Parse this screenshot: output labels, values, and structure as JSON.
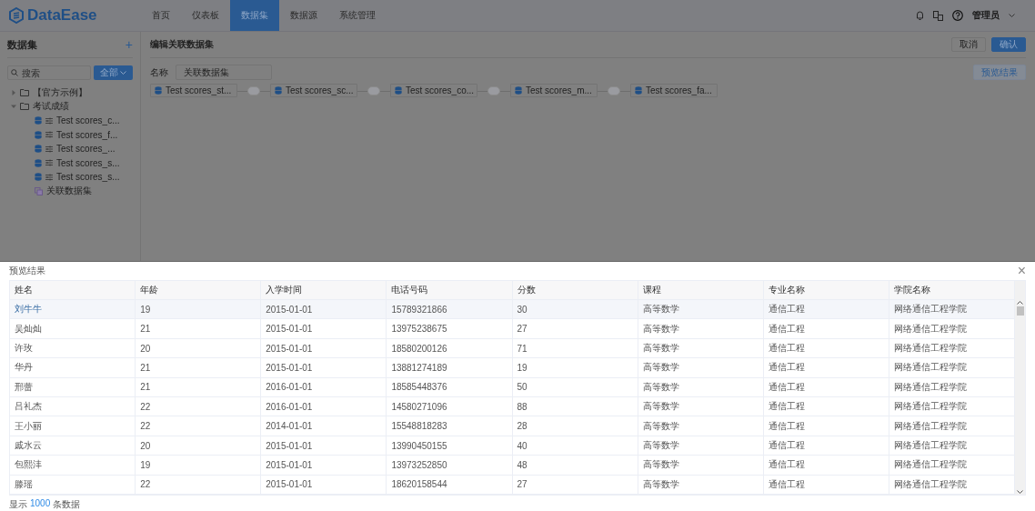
{
  "brand": {
    "name": "DataEase"
  },
  "nav": [
    {
      "label": "首页",
      "selected": false
    },
    {
      "label": "仪表板",
      "selected": false
    },
    {
      "label": "数据集",
      "selected": true
    },
    {
      "label": "数据源",
      "selected": false
    },
    {
      "label": "系统管理",
      "selected": false
    }
  ],
  "user": {
    "name": "管理员"
  },
  "sidebar": {
    "title": "数据集",
    "add": "+",
    "search": {
      "placeholder": "搜索"
    },
    "filter": "全部",
    "tree": [
      {
        "label": "【官方示例】",
        "kind": "folder",
        "expanded": false
      },
      {
        "label": "考试成绩",
        "kind": "folder",
        "expanded": true,
        "children": [
          {
            "label": "Test scores_c...",
            "kind": "dataset"
          },
          {
            "label": "Test scores_f...",
            "kind": "dataset"
          },
          {
            "label": "Test scores_...",
            "kind": "dataset"
          },
          {
            "label": "Test scores_s...",
            "kind": "dataset"
          },
          {
            "label": "Test scores_s...",
            "kind": "dataset"
          },
          {
            "label": "关联数据集",
            "kind": "union"
          }
        ]
      }
    ]
  },
  "editor": {
    "title": "编辑关联数据集",
    "cancel": "取消",
    "confirm": "确认",
    "name_label": "名称",
    "name_value": "关联数据集",
    "preview": "预览结果",
    "nodes": [
      "Test scores_st...",
      "Test scores_sc...",
      "Test scores_co...",
      "Test scores_m...",
      "Test scores_fa..."
    ]
  },
  "drawer": {
    "title": "预览结果",
    "close": "×",
    "columns": [
      "姓名",
      "年龄",
      "入学时间",
      "电话号码",
      "分数",
      "课程",
      "专业名称",
      "学院名称"
    ],
    "rows": [
      {
        "selected": true,
        "cells": [
          "刘牛牛",
          "19",
          "2015-01-01",
          "15789321866",
          "30",
          "高等数学",
          "通信工程",
          "网络通信工程学院"
        ]
      },
      {
        "selected": false,
        "cells": [
          "吴灿灿",
          "21",
          "2015-01-01",
          "13975238675",
          "27",
          "高等数学",
          "通信工程",
          "网络通信工程学院"
        ]
      },
      {
        "selected": false,
        "cells": [
          "许玫",
          "20",
          "2015-01-01",
          "18580200126",
          "71",
          "高等数学",
          "通信工程",
          "网络通信工程学院"
        ]
      },
      {
        "selected": false,
        "cells": [
          "华丹",
          "21",
          "2015-01-01",
          "13881274189",
          "19",
          "高等数学",
          "通信工程",
          "网络通信工程学院"
        ]
      },
      {
        "selected": false,
        "cells": [
          "邢蕾",
          "21",
          "2016-01-01",
          "18585448376",
          "50",
          "高等数学",
          "通信工程",
          "网络通信工程学院"
        ]
      },
      {
        "selected": false,
        "cells": [
          "吕礼杰",
          "22",
          "2016-01-01",
          "14580271096",
          "88",
          "高等数学",
          "通信工程",
          "网络通信工程学院"
        ]
      },
      {
        "selected": false,
        "cells": [
          "王小丽",
          "22",
          "2014-01-01",
          "15548818283",
          "28",
          "高等数学",
          "通信工程",
          "网络通信工程学院"
        ]
      },
      {
        "selected": false,
        "cells": [
          "戚水云",
          "20",
          "2015-01-01",
          "13990450155",
          "40",
          "高等数学",
          "通信工程",
          "网络通信工程学院"
        ]
      },
      {
        "selected": false,
        "cells": [
          "包熙沣",
          "19",
          "2015-01-01",
          "13973252850",
          "48",
          "高等数学",
          "通信工程",
          "网络通信工程学院"
        ]
      },
      {
        "selected": false,
        "cells": [
          "滕瑶",
          "22",
          "2015-01-01",
          "18620158544",
          "27",
          "高等数学",
          "通信工程",
          "网络通信工程学院"
        ]
      }
    ],
    "footer_prefix": "显示",
    "footer_count": "1000",
    "footer_suffix": "条数据"
  }
}
